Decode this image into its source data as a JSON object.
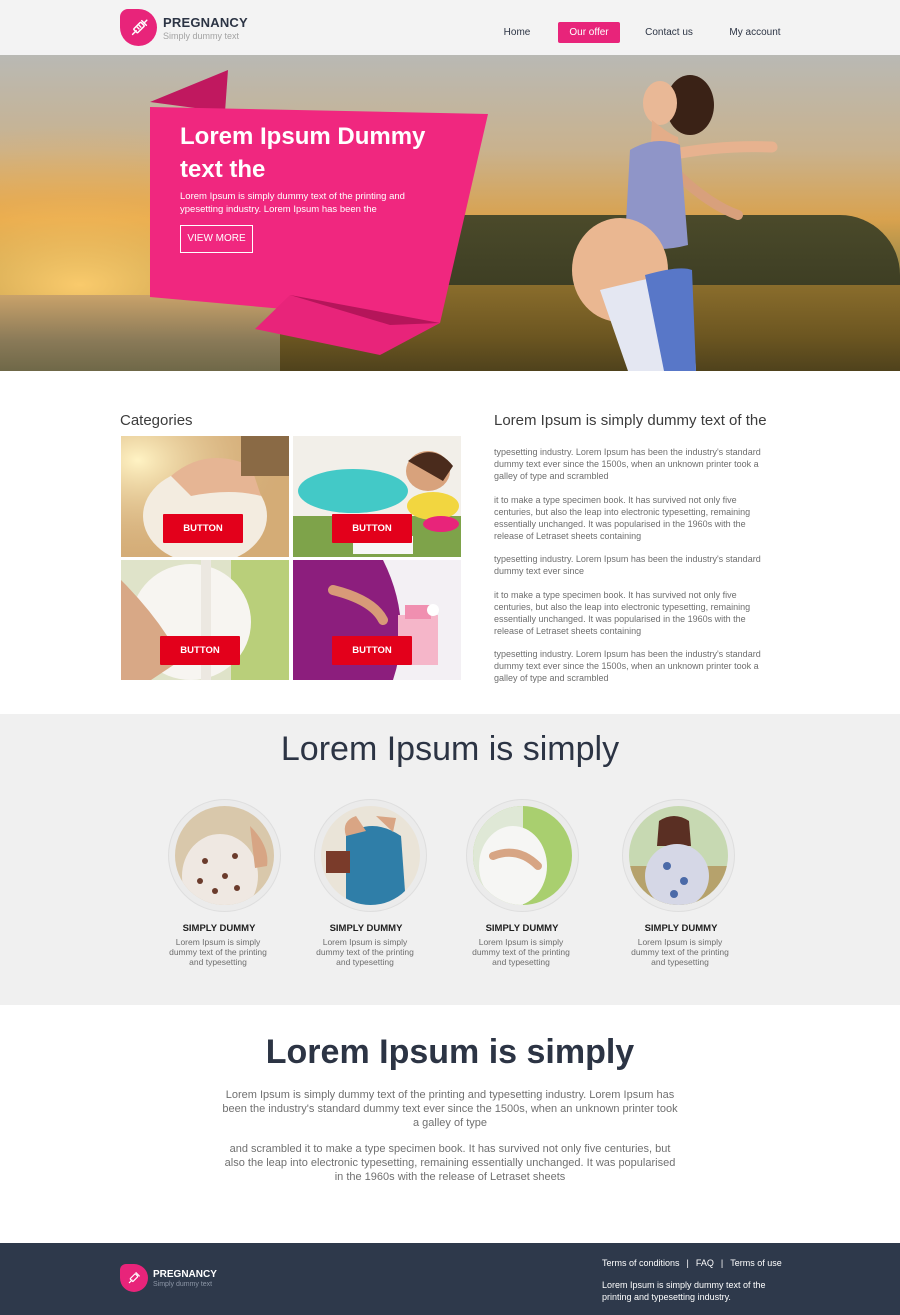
{
  "brand": {
    "name": "PREGNANCY",
    "tagline": "Simply dummy text",
    "accent": "#e8247a",
    "dark": "#2e394b",
    "button_red": "#e3001b"
  },
  "nav": {
    "items": [
      {
        "label": "Home",
        "active": false
      },
      {
        "label": "Our offer",
        "active": true
      },
      {
        "label": "Contact us",
        "active": false
      },
      {
        "label": "My account",
        "active": false
      }
    ]
  },
  "hero": {
    "title_line1": "Lorem Ipsum Dummy",
    "title_line2": "text the",
    "text": "Lorem Ipsum is simply dummy text of the printing and ypesetting industry. Lorem Ipsum has been the",
    "button": "VIEW MORE"
  },
  "categories": {
    "heading": "Categories",
    "tiles": [
      {
        "button": "BUTTON"
      },
      {
        "button": "BUTTON"
      },
      {
        "button": "BUTTON"
      },
      {
        "button": "BUTTON"
      }
    ]
  },
  "side": {
    "heading": "Lorem Ipsum is simply dummy text of the",
    "paragraphs": [
      "typesetting industry. Lorem Ipsum has been the industry's standard dummy text ever since the 1500s, when an unknown printer took a galley of type and scrambled",
      "it to make a type specimen book. It has survived not only five centuries, but also the leap into electronic typesetting, remaining essentially unchanged. It was popularised in the 1960s with the release of Letraset sheets containing",
      "typesetting industry. Lorem Ipsum has been the industry's standard dummy text ever since",
      "it to make a type specimen book. It has survived not only five centuries, but also the leap into electronic typesetting, remaining essentially unchanged. It was popularised in the 1960s with the release of Letraset sheets containing",
      "typesetting industry. Lorem Ipsum has been the industry's standard dummy text ever since the 1500s, when an unknown printer took a galley of type and scrambled"
    ]
  },
  "features": {
    "title": "Lorem Ipsum is simply",
    "items": [
      {
        "title": "SIMPLY DUMMY",
        "text": "Lorem Ipsum is simply dummy text of the printing and typesetting"
      },
      {
        "title": "SIMPLY DUMMY",
        "text": "Lorem Ipsum is simply dummy text of the printing and typesetting"
      },
      {
        "title": "SIMPLY DUMMY",
        "text": "Lorem Ipsum is simply dummy text of the printing and typesetting"
      },
      {
        "title": "SIMPLY DUMMY",
        "text": "Lorem Ipsum is simply dummy text of the printing and typesetting"
      }
    ]
  },
  "about": {
    "title": "Lorem Ipsum is simply",
    "paragraphs": [
      "Lorem Ipsum is simply dummy text of the printing and typesetting industry. Lorem Ipsum has been the industry's standard dummy text ever since the 1500s, when an unknown printer took a galley of type",
      "and scrambled it to make a type specimen book. It has survived not only five centuries, but also the leap into electronic typesetting, remaining essentially unchanged. It was popularised in the 1960s with the release of Letraset sheets"
    ]
  },
  "footer": {
    "links": [
      "Terms of conditions",
      "FAQ",
      "Terms of use"
    ],
    "text": "Lorem Ipsum is simply dummy text of the printing and typesetting industry."
  }
}
